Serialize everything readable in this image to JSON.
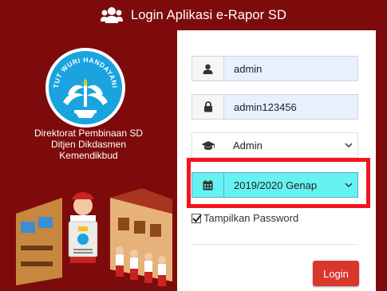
{
  "header": {
    "title": "Login Aplikasi e-Rapor SD",
    "icon": "users-icon"
  },
  "logo": {
    "motto": "TUT WURI HANDAYANI"
  },
  "org": {
    "line1": "Direktorat Pembinaan SD",
    "line2": "Ditjen Dikdasmen",
    "line3": "Kemendikbud"
  },
  "form": {
    "username": "admin",
    "password": "admin123456",
    "role": "Admin",
    "year": "2019/2020 Genap",
    "show_password_label": "Tampilkan Password",
    "show_password_checked": true,
    "login_label": "Login"
  },
  "colors": {
    "brand": "#7e0b0b",
    "button": "#d9372c",
    "highlight": "#f3141f",
    "selected": "#67f2f2"
  }
}
